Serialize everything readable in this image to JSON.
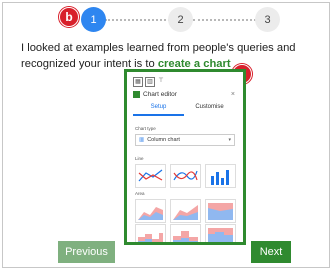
{
  "stepper": {
    "steps": [
      "1",
      "2",
      "3"
    ],
    "active_step": 1
  },
  "badges": {
    "b": "b",
    "a": "a"
  },
  "message": {
    "text": "I looked at examples learned from people's queries and recognized your intent is to ",
    "link": "create a chart"
  },
  "chart_editor": {
    "title": "Chart editor",
    "close": "×",
    "tabs": [
      "Setup",
      "Customise"
    ],
    "active_tab": "Setup",
    "chart_type_label": "Chart type",
    "chart_type_value": "Column chart",
    "section_line": "Line",
    "section_area": "Area"
  },
  "buttons": {
    "previous": "Previous",
    "next": "Next"
  },
  "colors": {
    "accent": "#2f8a2f",
    "step_active": "#2e86f0",
    "badge": "#d8202b"
  }
}
